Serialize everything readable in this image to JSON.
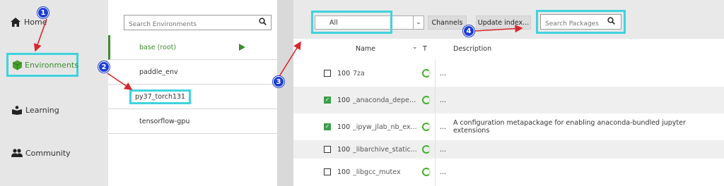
{
  "nav": {
    "items": [
      {
        "label": "Home",
        "icon": "home-icon"
      },
      {
        "label": "Environments",
        "icon": "cube-icon"
      },
      {
        "label": "Learning",
        "icon": "book-icon"
      },
      {
        "label": "Community",
        "icon": "people-icon"
      }
    ]
  },
  "environments": {
    "search_placeholder": "Search Environments",
    "items": [
      {
        "label": "base (root)",
        "active": true
      },
      {
        "label": "paddle_env"
      },
      {
        "label": "py37_torch131"
      },
      {
        "label": "tensorflow-gpu"
      }
    ]
  },
  "packages": {
    "filter_value": "All",
    "channels_label": "Channels",
    "update_label": "Update index...",
    "search_placeholder": "Search Packages",
    "header": {
      "name": "Name",
      "t": "T",
      "description": "Description"
    },
    "rows": [
      {
        "checked": false,
        "num": "100",
        "name": "7za",
        "dots": "...",
        "description": ""
      },
      {
        "checked": true,
        "num": "100",
        "name": "_anaconda_depends",
        "dots": "...",
        "description": ""
      },
      {
        "checked": true,
        "num": "100",
        "name": "_ipyw_jlab_nb_ex...",
        "dots": "...",
        "description": "A configuration metapackage for enabling anaconda-bundled jupyter extensions"
      },
      {
        "checked": false,
        "num": "100",
        "name": "_libarchive_static...",
        "dots": "...",
        "description": ""
      },
      {
        "checked": false,
        "num": "100",
        "name": "_libgcc_mutex",
        "dots": "...",
        "description": ""
      }
    ]
  },
  "annotations": [
    "1",
    "2",
    "3",
    "4"
  ],
  "colors": {
    "highlight": "#3fd3de",
    "accent": "#3b8c2e",
    "badge": "#1d3ed1",
    "arrow": "#d9262c"
  }
}
